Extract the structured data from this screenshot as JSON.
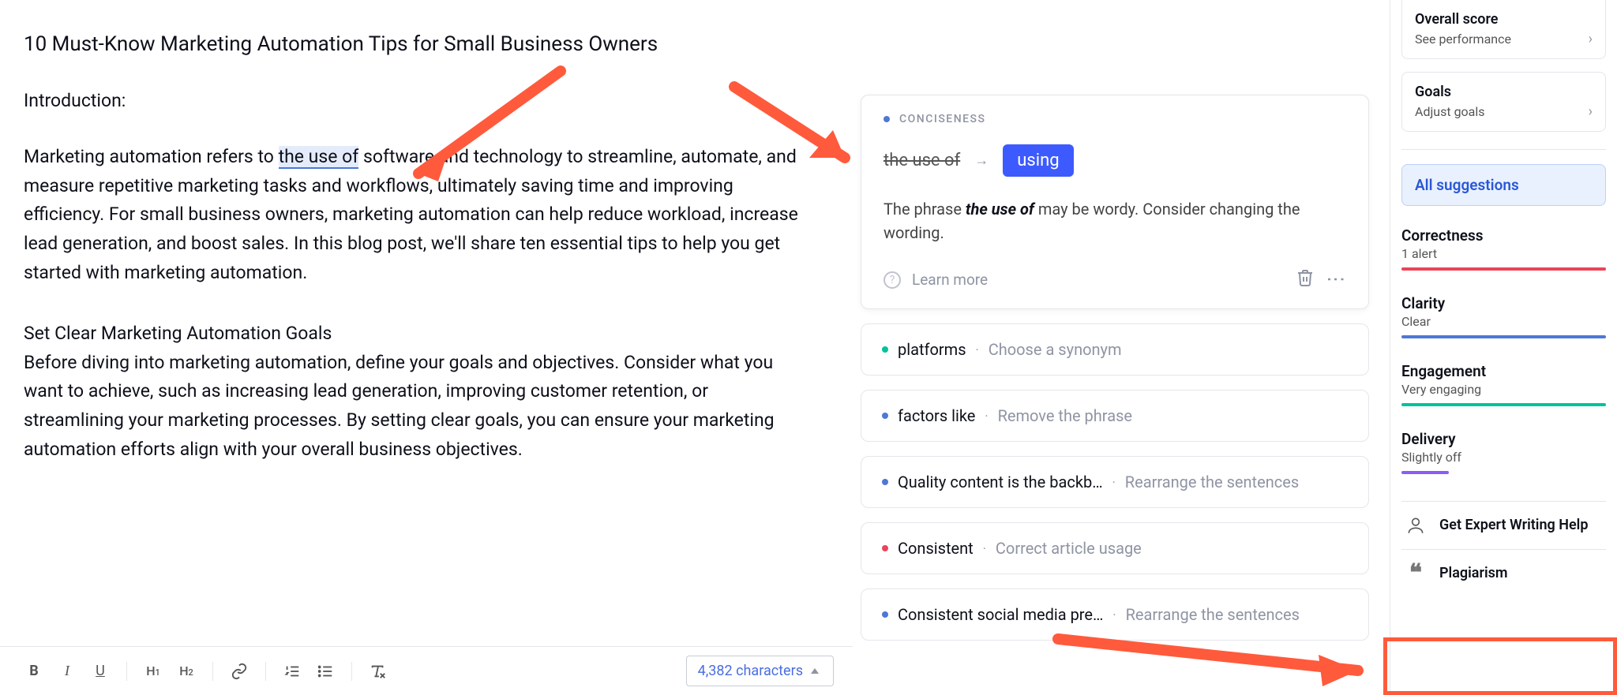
{
  "document": {
    "title": "10 Must-Know Marketing Automation Tips for Small Business Owners",
    "intro_label": "Introduction:",
    "p1_before": "Marketing automation refers to ",
    "p1_highlight": "the use of",
    "p1_after": " software and technology to streamline, automate, and measure repetitive marketing tasks and workflows, ultimately saving time and improving efficiency. For small business owners, marketing automation can help reduce workload, increase lead generation, and boost sales. In this blog post, we'll share ten essential tips to help you get started with marketing automation.",
    "h2": "Set Clear Marketing Automation Goals",
    "p2": "Before diving into marketing automation, define your goals and objectives. Consider what you want to achieve, such as increasing lead generation, improving customer retention, or streamlining your marketing processes. By setting clear goals, you can ensure your marketing automation efforts align with your overall business objectives."
  },
  "toolbar": {
    "bold": "B",
    "italic": "I",
    "underline": "U",
    "h1": "H",
    "h1_sub": "1",
    "h2": "H",
    "h2_sub": "2",
    "char_count": "4,382 characters"
  },
  "suggestion_card": {
    "category": "CONCISENESS",
    "strike_text": "the use of",
    "replacement": "using",
    "desc_1": "The phrase ",
    "desc_bold": "the use of",
    "desc_2": " may be wordy. Consider changing the wording.",
    "learn_more": "Learn more"
  },
  "suggestions": [
    {
      "dot": "teal",
      "text": "platforms",
      "hint": "Choose a synonym"
    },
    {
      "dot": "blue",
      "text": "factors like",
      "hint": "Remove the phrase"
    },
    {
      "dot": "blue",
      "text": "Quality content is the backb…",
      "hint": "Rearrange the sentences"
    },
    {
      "dot": "red",
      "text": "Consistent",
      "hint": "Correct article usage"
    },
    {
      "dot": "blue",
      "text": "Consistent social media pre…",
      "hint": "Rearrange the sentences"
    }
  ],
  "sidebar": {
    "overall": {
      "title": "Overall score",
      "sub": "See performance"
    },
    "goals": {
      "title": "Goals",
      "sub": "Adjust goals"
    },
    "filter_all": "All suggestions",
    "metrics": {
      "correctness": {
        "t": "Correctness",
        "s": "1 alert"
      },
      "clarity": {
        "t": "Clarity",
        "s": "Clear"
      },
      "engagement": {
        "t": "Engagement",
        "s": "Very engaging"
      },
      "delivery": {
        "t": "Delivery",
        "s": "Slightly off"
      }
    },
    "expert": "Get Expert Writing Help",
    "plagiarism": "Plagiarism"
  }
}
